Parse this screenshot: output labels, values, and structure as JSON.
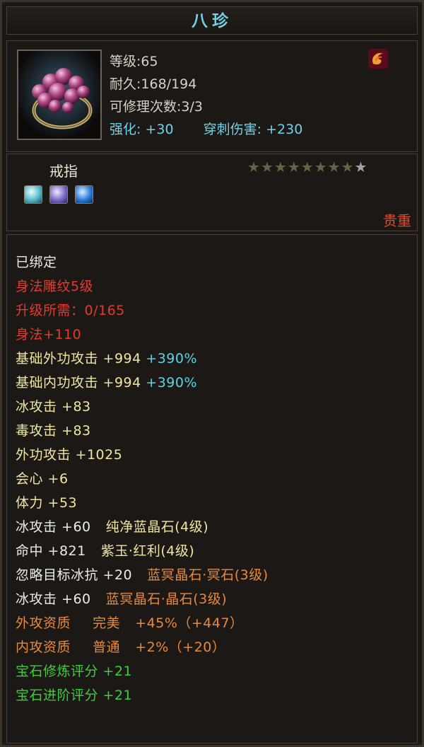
{
  "title": "八珍",
  "header": {
    "level": "等级:65",
    "durability": "耐久:168/194",
    "repair": "可修理次数:3/3",
    "enhance_label": "强化:",
    "enhance_value": "+30",
    "pierce_label": "穿刺伤害:",
    "pierce_value": "+230",
    "item_icon": "ring-icon",
    "badge_icon": "red-swirl-badge-icon"
  },
  "sub": {
    "type": "戒指",
    "gems": [
      "gem-cyan-icon",
      "gem-purple-icon",
      "gem-blue-icon"
    ],
    "stars_filled": 8,
    "stars_total": 9,
    "rarity": "贵重"
  },
  "colors": {
    "title": "#6fd2e8",
    "red": "#e23b2e",
    "yellow": "#f0e6a0",
    "cyan": "#5bd3e6",
    "orange": "#e88a3a",
    "green": "#3fcc3f"
  },
  "attrs": {
    "bound": "已绑定",
    "carving": "身法雕纹5级",
    "upgrade": "升级所需：0/165",
    "agility": "身法+110",
    "base_outer_label": "基础外功攻击 +994",
    "base_outer_pct": "+390%",
    "base_inner_label": "基础内功攻击 +994",
    "base_inner_pct": "+390%",
    "ice_atk": "冰攻击 +83",
    "poison_atk": "毒攻击 +83",
    "outer_atk": "外功攻击 +1025",
    "crit": "会心 +6",
    "stamina": "体力 +53",
    "gem1_stat": "冰攻击 +60",
    "gem1_name": "纯净蓝晶石(4级)",
    "gem2_stat": "命中 +821",
    "gem2_name": "紫玉·红利(4级)",
    "gem3_stat": "忽略目标冰抗 +20",
    "gem3_name": "蓝冥晶石·冥石(3级)",
    "gem4_stat": "冰攻击 +60",
    "gem4_name": "蓝冥晶石·晶石(3级)",
    "q1_label": "外攻资质",
    "q1_grade": "完美",
    "q1_value": "+45%（+447）",
    "q2_label": "内攻资质",
    "q2_grade": "普通",
    "q2_value": "+2%（+20）",
    "refine": "宝石修炼评分 +21",
    "advance": "宝石进阶评分 +21"
  }
}
